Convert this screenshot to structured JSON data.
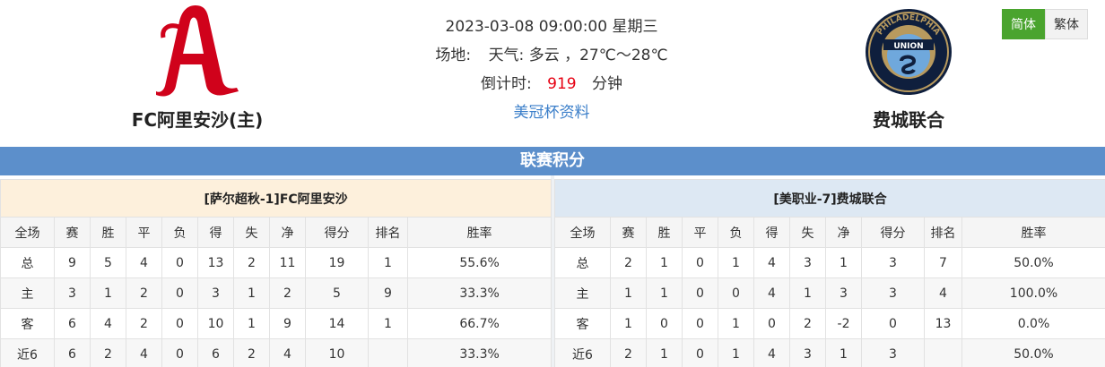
{
  "header": {
    "datetime": "2023-03-08 09:00:00 星期三",
    "venue_label": "场地:",
    "weather_label": "天气:",
    "weather_value": "多云 ，27℃～28℃",
    "countdown_label": "倒计时:",
    "countdown_value": "919",
    "countdown_unit": "分钟",
    "league_link": "美冠杯资料"
  },
  "home_team": {
    "name": "FC阿里安沙(主)",
    "logo_icon": "alianza-a-logo",
    "brand_color": "#d0021b"
  },
  "away_team": {
    "name": "费城联合",
    "logo_icon": "philadelphia-union-crest",
    "logo_text_top": "PHILADELPHIA",
    "logo_text_mid": "UNION"
  },
  "lang": {
    "simplified": "简体",
    "traditional": "繁体"
  },
  "section_title": "联赛积分",
  "columns": [
    "全场",
    "赛",
    "胜",
    "平",
    "负",
    "得",
    "失",
    "净",
    "得分",
    "排名",
    "胜率"
  ],
  "left_table": {
    "title": "[萨尔超秋-1]FC阿里安沙",
    "rows": [
      [
        "总",
        "9",
        "5",
        "4",
        "0",
        "13",
        "2",
        "11",
        "19",
        "1",
        "55.6%"
      ],
      [
        "主",
        "3",
        "1",
        "2",
        "0",
        "3",
        "1",
        "2",
        "5",
        "9",
        "33.3%"
      ],
      [
        "客",
        "6",
        "4",
        "2",
        "0",
        "10",
        "1",
        "9",
        "14",
        "1",
        "66.7%"
      ],
      [
        "近6",
        "6",
        "2",
        "4",
        "0",
        "6",
        "2",
        "4",
        "10",
        "",
        "33.3%"
      ]
    ]
  },
  "right_table": {
    "title": "[美职业-7]费城联合",
    "rows": [
      [
        "总",
        "2",
        "1",
        "0",
        "1",
        "4",
        "3",
        "1",
        "3",
        "7",
        "50.0%"
      ],
      [
        "主",
        "1",
        "1",
        "0",
        "0",
        "4",
        "1",
        "3",
        "3",
        "4",
        "100.0%"
      ],
      [
        "客",
        "1",
        "0",
        "0",
        "1",
        "0",
        "2",
        "-2",
        "0",
        "13",
        "0.0%"
      ],
      [
        "近6",
        "2",
        "1",
        "0",
        "1",
        "4",
        "3",
        "1",
        "3",
        "",
        "50.0%"
      ]
    ]
  }
}
